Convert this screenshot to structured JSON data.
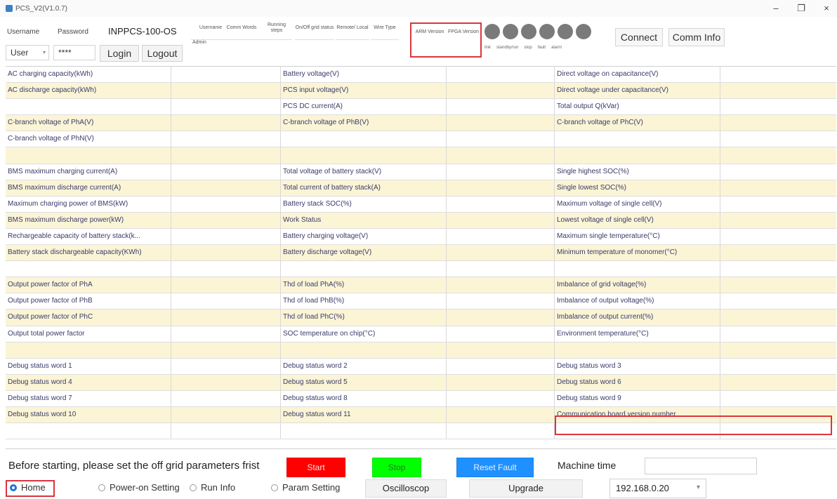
{
  "window": {
    "title": "PCS_V2(V1.0.7)",
    "minimize": "–",
    "maximize": "❐",
    "close": "×"
  },
  "toolbar": {
    "username_label": "Username",
    "password_label": "Password",
    "model": "INPPCS-100-OS",
    "user_value": "User",
    "password_value": "****",
    "login": "Login",
    "logout": "Logout",
    "grid_headers": [
      "Username",
      "Comm Words",
      "Running steps",
      "On/Off grid status",
      "Remote/ Local",
      "Wire Type",
      "ARM Version",
      "FPGA Version"
    ],
    "grid_values": [
      "Admin",
      "",
      "",
      "",
      "",
      "",
      "",
      ""
    ],
    "led_labels": [
      "link",
      "standby/run",
      "stop",
      "fault",
      "alarm"
    ],
    "connect": "Connect",
    "comm_info": "Comm Info"
  },
  "table": {
    "rows": [
      [
        "AC charging capacity(kWh)",
        "",
        "Battery voltage(V)",
        "",
        "Direct voltage on capacitance(V)",
        ""
      ],
      [
        "AC discharge capacity(kWh)",
        "",
        "PCS input voltage(V)",
        "",
        "Direct voltage under capacitance(V)",
        ""
      ],
      [
        "",
        "",
        "PCS DC current(A)",
        "",
        "Total output Q(kVar)",
        ""
      ],
      [
        "C-branch voltage of PhA(V)",
        "",
        "C-branch voltage of PhB(V)",
        "",
        "C-branch voltage of PhC(V)",
        ""
      ],
      [
        "C-branch voltage of PhN(V)",
        "",
        "",
        "",
        "",
        ""
      ],
      [
        "",
        "",
        "",
        "",
        "",
        ""
      ],
      [
        "BMS maximum charging current(A)",
        "",
        "Total voltage of battery stack(V)",
        "",
        "Single highest SOC(%)",
        ""
      ],
      [
        "BMS maximum discharge current(A)",
        "",
        "Total current of battery stack(A)",
        "",
        "Single lowest SOC(%)",
        ""
      ],
      [
        "Maximum charging power of BMS(kW)",
        "",
        "Battery stack SOC(%)",
        "",
        "Maximum voltage of single cell(V)",
        ""
      ],
      [
        "BMS maximum discharge power(kW)",
        "",
        "Work Status",
        "",
        "Lowest voltage of single cell(V)",
        ""
      ],
      [
        "Rechargeable capacity of battery stack(k...",
        "",
        "Battery charging voltage(V)",
        "",
        "Maximum single temperature(°C)",
        ""
      ],
      [
        "Battery stack dischargeable capacity(KWh)",
        "",
        "Battery discharge voltage(V)",
        "",
        "Minimum temperature of monomer(°C)",
        ""
      ],
      [
        "",
        "",
        "",
        "",
        "",
        ""
      ],
      [
        "Output power factor of PhA",
        "",
        "Thd of load PhA(%)",
        "",
        "Imbalance of grid voltage(%)",
        ""
      ],
      [
        "Output power factor of PhB",
        "",
        "Thd of load PhB(%)",
        "",
        "Imbalance of output voltage(%)",
        ""
      ],
      [
        "Output power factor of PhC",
        "",
        "Thd of load PhC(%)",
        "",
        "Imbalance of output current(%)",
        ""
      ],
      [
        "Output total power factor",
        "",
        "SOC temperature on chip(°C)",
        "",
        "Environment temperature(°C)",
        ""
      ],
      [
        "",
        "",
        "",
        "",
        "",
        ""
      ],
      [
        "Debug status word 1",
        "",
        "Debug status word 2",
        "",
        "Debug status word 3",
        ""
      ],
      [
        "Debug status word 4",
        "",
        "Debug status word 5",
        "",
        "Debug status word 6",
        ""
      ],
      [
        "Debug status word 7",
        "",
        "Debug status word 8",
        "",
        "Debug status word 9",
        ""
      ],
      [
        "Debug status word 10",
        "",
        "Debug status word 11",
        "",
        "Communication board version number",
        ""
      ],
      [
        "",
        "",
        "",
        "",
        "",
        ""
      ]
    ],
    "row_colors": [
      "#ffffff",
      "#fbf5d6"
    ]
  },
  "bottom": {
    "notice": "Before starting, please set the off grid parameters frist",
    "start": "Start",
    "stop": "Stop",
    "reset_fault": "Reset Fault",
    "machine_time_label": "Machine time",
    "machine_time_value": "",
    "nav": {
      "home": "Home",
      "power_on_setting": "Power-on Setting",
      "run_info": "Run Info",
      "param_setting": "Param Setting",
      "oscilloscop": "Oscilloscop",
      "upgrade": "Upgrade"
    },
    "ip": "192.168.0.20"
  },
  "colors": {
    "highlight": "#d9363e",
    "start": "#ff0000",
    "stop": "#00ff00",
    "reset": "#1e90ff",
    "led": "#7a7a7a",
    "radio_active": "#1e73d8"
  }
}
